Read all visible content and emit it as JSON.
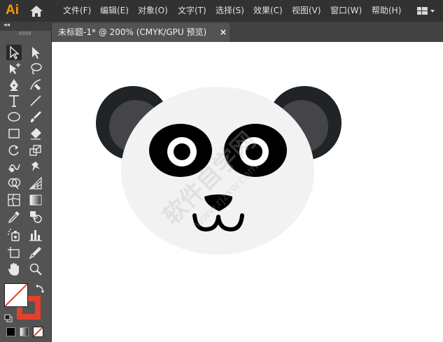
{
  "app": {
    "logo": "Ai"
  },
  "menu": [
    {
      "label": "文件(F)"
    },
    {
      "label": "编辑(E)"
    },
    {
      "label": "对象(O)"
    },
    {
      "label": "文字(T)"
    },
    {
      "label": "选择(S)"
    },
    {
      "label": "效果(C)"
    },
    {
      "label": "视图(V)"
    },
    {
      "label": "窗口(W)"
    },
    {
      "label": "帮助(H)"
    }
  ],
  "toolbar": {
    "collapse_label": "◂◂"
  },
  "document": {
    "tab_title": "未标题-1* @ 200% (CMYK/GPU 预览)",
    "close_label": "×"
  },
  "watermark": {
    "line1": "软件自学网",
    "line2": "www.rjzxw.com"
  },
  "colors": {
    "menubar": "#323232",
    "toolbar": "#535353",
    "canvas": "#ffffff",
    "panda_face": "#f2f2f2",
    "panda_dark": "#000000",
    "ear_outer": "#202427",
    "ear_inner": "#444449",
    "stroke_swatch": "#e3412c"
  }
}
